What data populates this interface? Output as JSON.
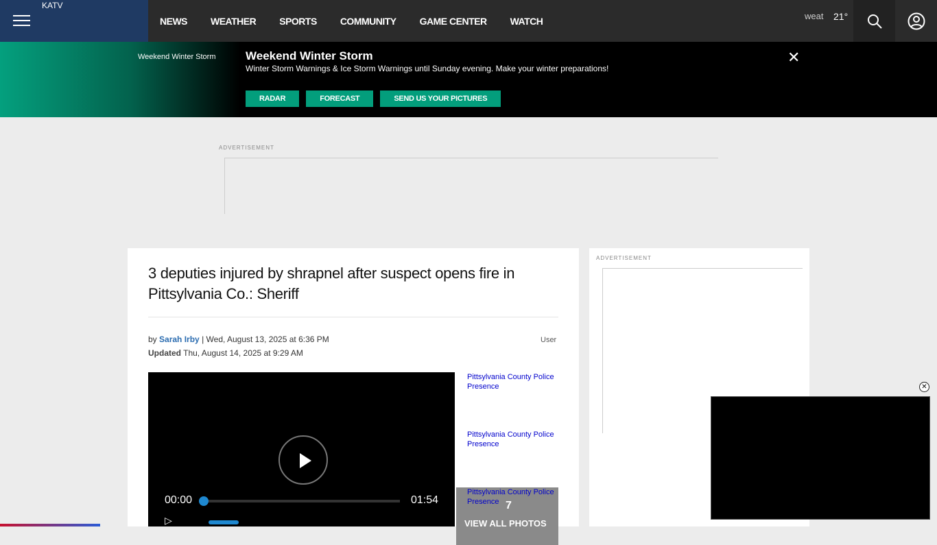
{
  "header": {
    "logo_alt": "KATV",
    "nav": [
      "NEWS",
      "WEATHER",
      "SPORTS",
      "COMMUNITY",
      "GAME CENTER",
      "WATCH"
    ],
    "weather_alt": "weat",
    "temperature": "21°"
  },
  "alert": {
    "image_alt": "Weekend Winter Storm",
    "title": "Weekend Winter Storm",
    "text": "Winter Storm Warnings & Ice Storm Warnings until Sunday evening. Make your winter preparations!",
    "buttons": [
      "RADAR",
      "FORECAST",
      "SEND US YOUR PICTURES"
    ],
    "close": "✕"
  },
  "ads": {
    "label": "ADVERTISEMENT"
  },
  "article": {
    "title": "3 deputies injured by shrapnel after suspect opens fire in Pittsylvania Co.: Sheriff",
    "by": "by",
    "author": "Sarah Irby",
    "published": "| Wed, August 13, 2025 at 6:36 PM",
    "updated_label": "Updated",
    "updated": "Thu, August 14, 2025 at 9:29 AM",
    "user_img_alt": "User"
  },
  "video": {
    "current_time": "00:00",
    "duration": "01:54"
  },
  "gallery": {
    "thumbs": [
      "Pittsylvania County Police Presence",
      "Pittsylvania County Police Presence",
      "Pittsylvania County Police Presence"
    ],
    "count": "7",
    "view_all": "VIEW ALL PHOTOS"
  }
}
